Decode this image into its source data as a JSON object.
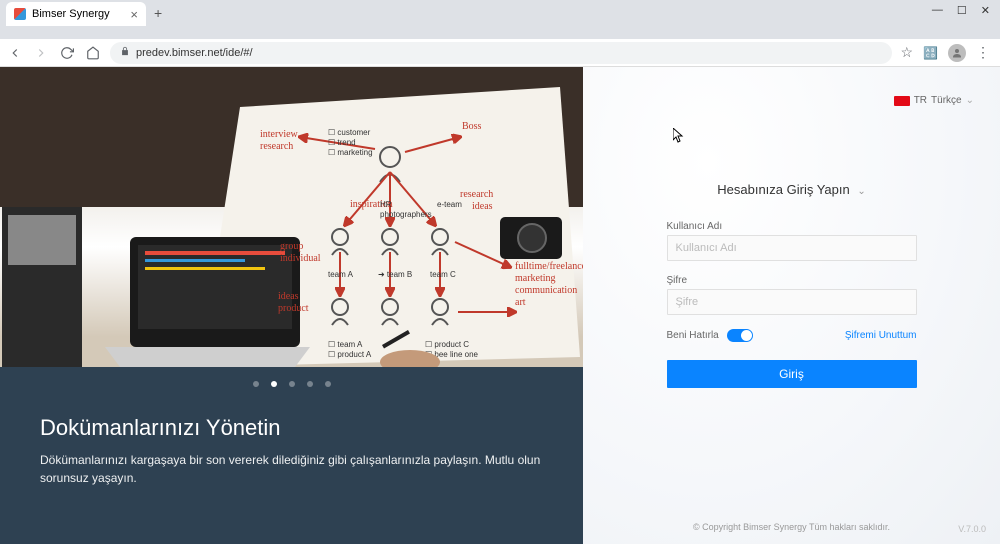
{
  "browser": {
    "tab_title": "Bimser Synergy",
    "url": "predev.bimser.net/ide/#/"
  },
  "lang": {
    "code": "TR",
    "label": "Türkçe"
  },
  "hero": {
    "title": "Dokümanlarınızı Yönetin",
    "subtitle": "Dökümanlarınızı kargaşaya bir son vererek dilediğiniz gibi çalışanlarınızla paylaşın. Mutlu olun sorunsuz yaşayın.",
    "active_dot": 1,
    "dot_count": 5
  },
  "login": {
    "heading": "Hesabınıza Giriş Yapın",
    "username_label": "Kullanıcı Adı",
    "username_placeholder": "Kullanıcı Adı",
    "password_label": "Şifre",
    "password_placeholder": "Şifre",
    "remember_label": "Beni Hatırla",
    "forgot_label": "Şifremi Unuttum",
    "submit_label": "Giriş"
  },
  "footer": {
    "copyright": "© Copyright Bimser Synergy Tüm hakları saklıdır.",
    "version": "V.7.0.0"
  }
}
